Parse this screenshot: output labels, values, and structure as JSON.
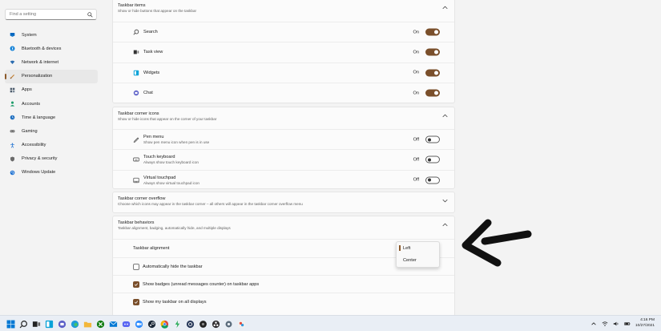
{
  "search": {
    "placeholder": "Find a setting"
  },
  "sidebar": {
    "items": [
      {
        "label": "System",
        "icon": "monitor-icon",
        "color": "#0067c0"
      },
      {
        "label": "Bluetooth & devices",
        "icon": "bluetooth-icon",
        "color": "#0078d4"
      },
      {
        "label": "Network & internet",
        "icon": "wifi-icon",
        "color": "#2b6cb0"
      },
      {
        "label": "Personalization",
        "icon": "brush-icon",
        "color": "#c27c2c",
        "active": true
      },
      {
        "label": "Apps",
        "icon": "apps-icon",
        "color": "#4a5a6a"
      },
      {
        "label": "Accounts",
        "icon": "person-icon",
        "color": "#1f9d6b"
      },
      {
        "label": "Time & language",
        "icon": "clock-globe-icon",
        "color": "#1f6fc0"
      },
      {
        "label": "Gaming",
        "icon": "gamepad-icon",
        "color": "#6b6b6b"
      },
      {
        "label": "Accessibility",
        "icon": "accessibility-icon",
        "color": "#1a6fd1"
      },
      {
        "label": "Privacy & security",
        "icon": "shield-icon",
        "color": "#6b6b6b"
      },
      {
        "label": "Windows Update",
        "icon": "update-icon",
        "color": "#1a6fd1"
      }
    ]
  },
  "sections": {
    "items": {
      "title": "Taskbar items",
      "subtitle": "Show or hide buttons that appear on the taskbar",
      "rows": [
        {
          "label": "Search",
          "state": "On",
          "icon": "search-icon"
        },
        {
          "label": "Task view",
          "state": "On",
          "icon": "taskview-icon"
        },
        {
          "label": "Widgets",
          "state": "On",
          "icon": "widgets-icon"
        },
        {
          "label": "Chat",
          "state": "On",
          "icon": "chat-icon"
        }
      ]
    },
    "corner": {
      "title": "Taskbar corner icons",
      "subtitle": "Show or hide icons that appear on the corner of your taskbar",
      "rows": [
        {
          "label": "Pen menu",
          "sub": "Show pen menu icon when pen is in use",
          "state": "Off",
          "icon": "pen-icon"
        },
        {
          "label": "Touch keyboard",
          "sub": "Always show touch keyboard icon",
          "state": "Off",
          "icon": "keyboard-icon"
        },
        {
          "label": "Virtual touchpad",
          "sub": "Always show virtual touchpad icon",
          "state": "Off",
          "icon": "touchpad-icon"
        }
      ]
    },
    "overflow": {
      "title": "Taskbar corner overflow",
      "subtitle": "Choose which icons may appear in the taskbar corner – all others will appear in the taskbar corner overflow menu"
    },
    "behaviors": {
      "title": "Taskbar behaviors",
      "subtitle": "Taskbar alignment, badging, automatically hide, and multiple displays",
      "alignment_label": "Taskbar alignment",
      "rows": [
        {
          "label": "Automatically hide the taskbar",
          "checked": false
        },
        {
          "label": "Show badges (unread messages counter) on taskbar apps",
          "checked": true
        },
        {
          "label": "Show my taskbar on all displays",
          "checked": true
        }
      ]
    }
  },
  "dropdown": {
    "options": [
      "Left",
      "Center"
    ],
    "selected": "Left"
  },
  "tray": {
    "time": "4:16 PM",
    "date": "10/27/2021"
  },
  "colors": {
    "accent": "#7a4f2b",
    "accent_bar": "#8b5a2b"
  }
}
